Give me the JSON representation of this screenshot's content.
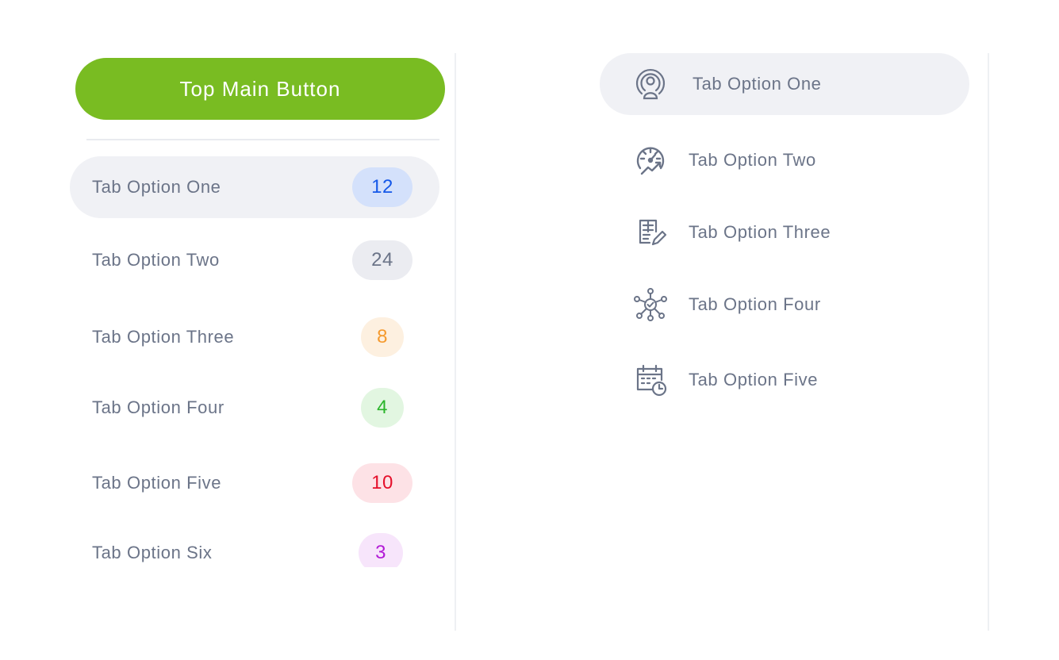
{
  "main_button": {
    "label": "Top Main Button",
    "color": "#79bc22"
  },
  "left_tabs": [
    {
      "label": "Tab Option One",
      "count": "12",
      "badge_bg": "#d4e1fb",
      "badge_fg": "#1558e8",
      "active": true
    },
    {
      "label": "Tab Option Two",
      "count": "24",
      "badge_bg": "#ebecf1",
      "badge_fg": "#6b7488",
      "active": false
    },
    {
      "label": "Tab Option Three",
      "count": "8",
      "badge_bg": "#fdf0e0",
      "badge_fg": "#f59a2e",
      "active": false
    },
    {
      "label": "Tab Option Four",
      "count": "4",
      "badge_bg": "#e2f6e1",
      "badge_fg": "#2bb52b",
      "active": false
    },
    {
      "label": "Tab Option Five",
      "count": "10",
      "badge_bg": "#fde2e6",
      "badge_fg": "#e5102b",
      "active": false
    },
    {
      "label": "Tab Option Six",
      "count": "3",
      "badge_bg": "#f7e5fb",
      "badge_fg": "#b21ad6",
      "active": false
    }
  ],
  "right_tabs": [
    {
      "label": "Tab Option One",
      "icon": "broadcast-user-icon",
      "active": true
    },
    {
      "label": "Tab Option Two",
      "icon": "speedometer-chart-icon",
      "active": false
    },
    {
      "label": "Tab Option Three",
      "icon": "edit-document-icon",
      "active": false
    },
    {
      "label": "Tab Option Four",
      "icon": "network-hub-icon",
      "active": false
    },
    {
      "label": "Tab Option Five",
      "icon": "calendar-clock-icon",
      "active": false
    }
  ]
}
